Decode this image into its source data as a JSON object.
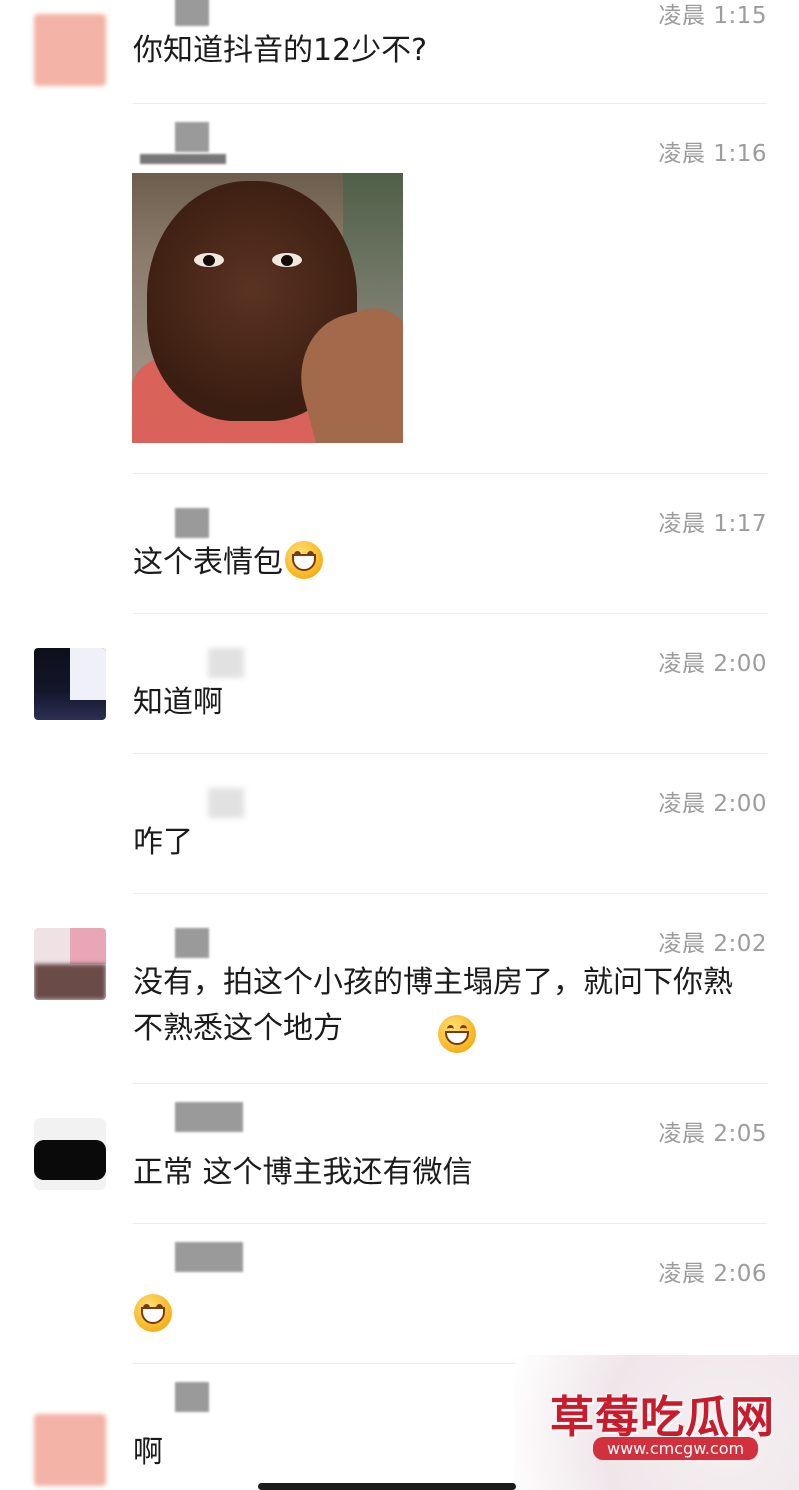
{
  "messages": [
    {
      "time": "凌晨 1:15",
      "text": "你知道抖音的12少不?"
    },
    {
      "time": "凌晨 1:16",
      "image": "child-photo"
    },
    {
      "time": "凌晨 1:17",
      "text": "这个表情包"
    },
    {
      "time": "凌晨 2:00",
      "text": "知道啊"
    },
    {
      "time": "凌晨 2:00",
      "text": "咋了"
    },
    {
      "time": "凌晨 2:02",
      "text": "没有，拍这个小孩的博主塌房了，就问下你熟不熟悉这个地方"
    },
    {
      "time": "凌晨 2:05",
      "text": "正常 这个博主我还有微信"
    },
    {
      "time": "凌晨 2:06",
      "text": ""
    },
    {
      "time": "",
      "text": "啊"
    }
  ],
  "watermark": {
    "title": "草莓吃瓜网",
    "url": "www.cmcgw.com"
  }
}
